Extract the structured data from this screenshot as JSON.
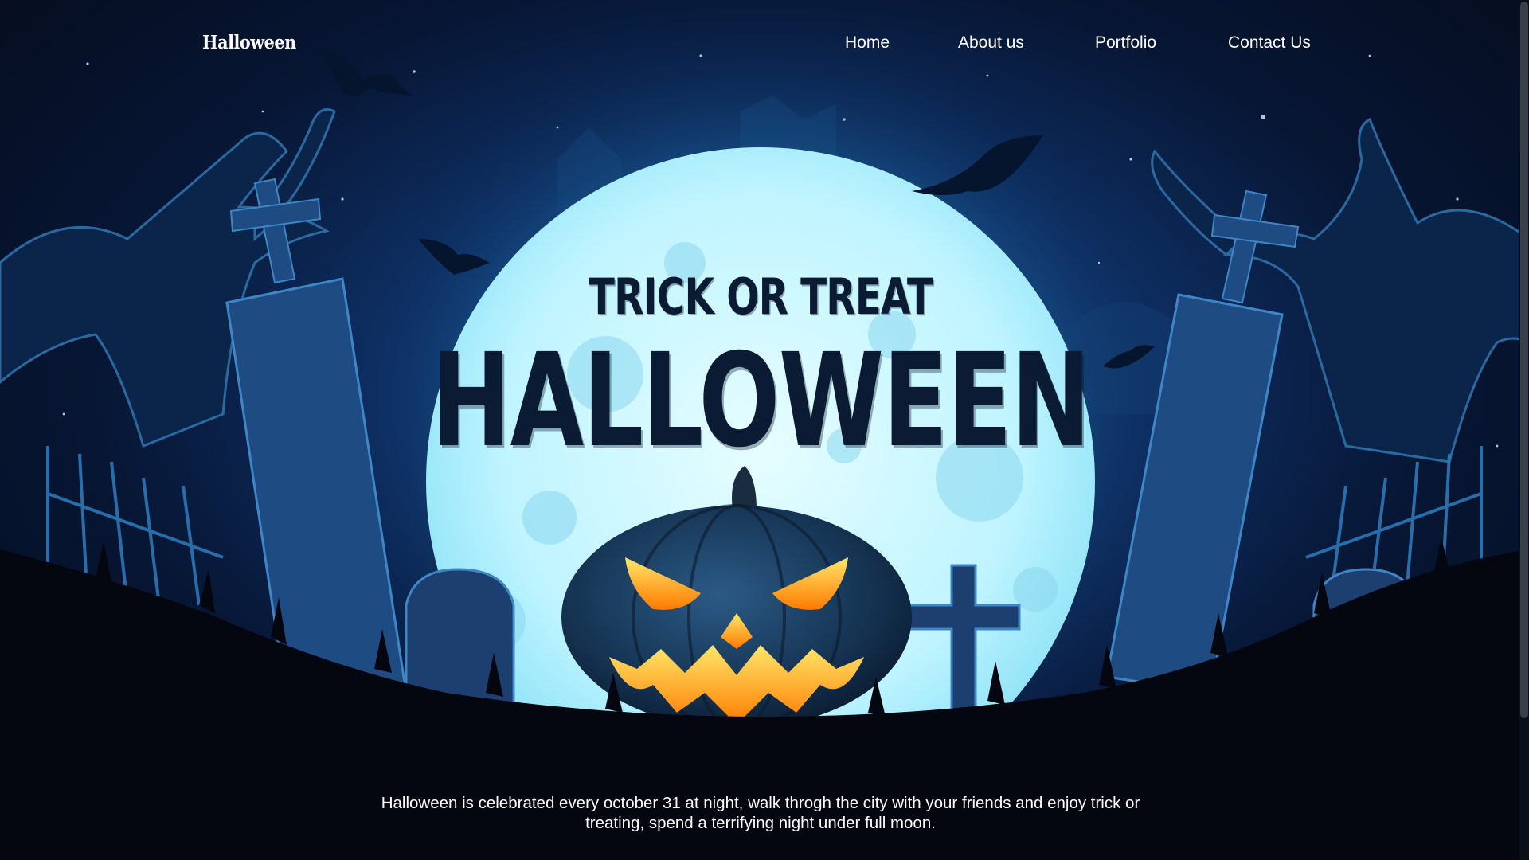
{
  "logo": {
    "text": "Halloween"
  },
  "nav": {
    "items": [
      {
        "label": "Home"
      },
      {
        "label": "About us"
      },
      {
        "label": "Portfolio"
      },
      {
        "label": "Contact Us"
      }
    ]
  },
  "hero": {
    "subtitle": "TRICK OR TREAT",
    "title": "HALLOWEEN",
    "description": "Halloween is celebrated every october 31 at night, walk throgh the city with your friends and enjoy trick or treating, spend a terrifying night under full moon."
  },
  "colors": {
    "sky_dark": "#050b1a",
    "sky_mid": "#0e2f63",
    "moon": "#bff4ff",
    "pumpkin": "#14314f",
    "pumpkin_glow": "#ffb21a",
    "ground": "#04070f",
    "title_text": "#0b1b33"
  }
}
